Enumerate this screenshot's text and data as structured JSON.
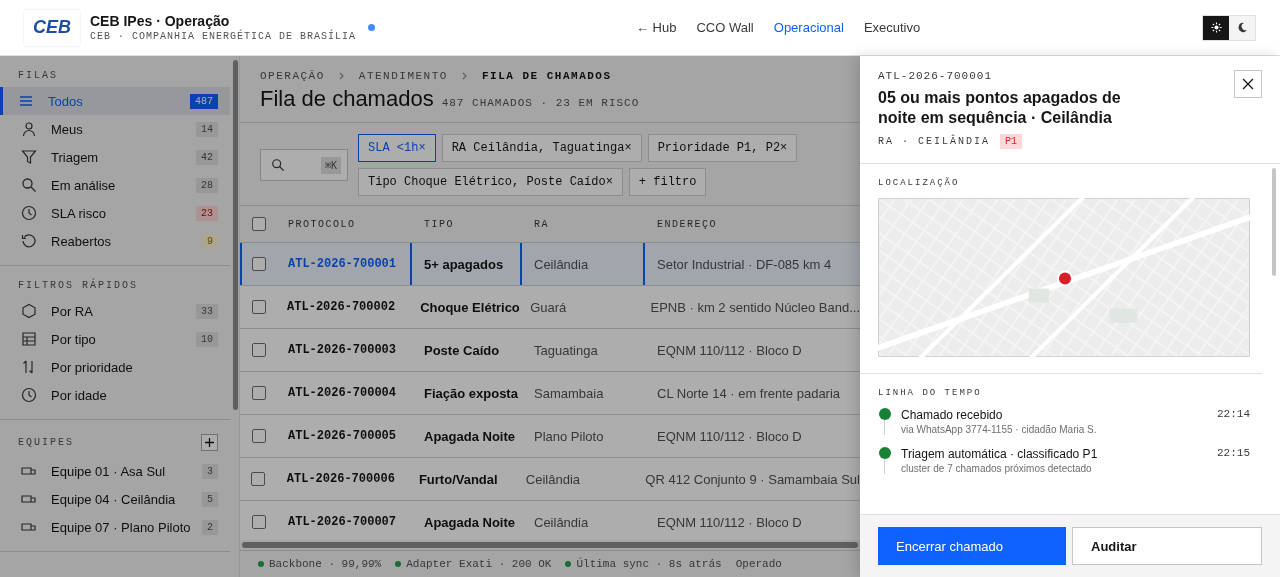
{
  "header": {
    "logo": "CEB",
    "title": "CEB IPes · Operação",
    "subtitle": "CEB · COMPANHIA ENERGÉTICA DE BRASÍLIA",
    "online": true,
    "nav": [
      {
        "label": "← Hub",
        "selected": false
      },
      {
        "label": "CCO Wall",
        "selected": false
      },
      {
        "label": "Operacional",
        "selected": true
      },
      {
        "label": "Executivo",
        "selected": false
      }
    ],
    "theme": [
      {
        "kind": "sun",
        "selected": true
      },
      {
        "kind": "moon",
        "selected": false
      }
    ]
  },
  "sidebar": {
    "sections": [
      {
        "title": "FILAS",
        "items": [
          {
            "label": "Todos",
            "count": "487",
            "kind": "primary",
            "selected": true
          },
          {
            "label": "Meus",
            "count": "14",
            "kind": "neutral",
            "selected": false
          },
          {
            "label": "Triagem",
            "count": "42",
            "kind": "neutral",
            "selected": false
          },
          {
            "label": "Em análise",
            "count": "28",
            "kind": "neutral",
            "selected": false
          },
          {
            "label": "SLA risco",
            "count": "23",
            "kind": "danger",
            "selected": false
          },
          {
            "label": "Reabertos",
            "count": "9",
            "kind": "warning",
            "selected": false
          }
        ]
      },
      {
        "title": "FILTROS RÁPIDOS",
        "items": [
          {
            "label": "Por RA",
            "count": "33",
            "kind": "neutral",
            "selected": false
          },
          {
            "label": "Por tipo",
            "count": "10",
            "kind": "neutral",
            "selected": false
          },
          {
            "label": "Por prioridade",
            "selected": false
          },
          {
            "label": "Por idade",
            "selected": false
          }
        ]
      },
      {
        "title": "EQUIPES",
        "addable": true,
        "items": [
          {
            "label": "Equipe 01 · Asa Sul",
            "count": "3",
            "kind": "neutral",
            "selected": false
          },
          {
            "label": "Equipe 04 · Ceilândia",
            "count": "5",
            "kind": "neutral",
            "selected": false
          },
          {
            "label": "Equipe 07 · Plano Piloto",
            "count": "2",
            "kind": "neutral",
            "selected": false
          }
        ]
      }
    ]
  },
  "main": {
    "breadcrumb": [
      "OPERAÇÃO",
      "ATENDIMENTO",
      "FILA DE CHAMADOS"
    ],
    "title": "Fila de chamados",
    "summary": "487 CHAMADOS · 23 EM RISCO",
    "search": {
      "shortcut": "⌘K"
    },
    "filters": [
      {
        "label": "SLA <1h",
        "active": true,
        "removable": true
      },
      {
        "label": "RA Ceilândia, Taguatinga",
        "active": false,
        "removable": true
      },
      {
        "label": "Prioridade P1, P2",
        "active": false,
        "removable": true
      },
      {
        "label": "Tipo Choque Elétrico, Poste Caído",
        "active": false,
        "removable": true
      },
      {
        "label": "+ filtro",
        "active": false,
        "removable": false
      }
    ],
    "remove_mark": "×",
    "table": {
      "all_checked": false,
      "columns": [
        "PROTOCOLO",
        "TIPO",
        "RA",
        "ENDEREÇO"
      ],
      "rows": [
        {
          "protocolo": "ATL-2026-700001",
          "tipo": "5+ apagados",
          "ra": "Ceilândia",
          "endereco": "Setor Industrial · DF-085 km 4",
          "checked": false,
          "selected": true
        },
        {
          "protocolo": "ATL-2026-700002",
          "tipo": "Choque Elétrico",
          "ra": "Guará",
          "endereco": "EPNB · km 2 sentido Núcleo Band...",
          "checked": false,
          "selected": false
        },
        {
          "protocolo": "ATL-2026-700003",
          "tipo": "Poste Caído",
          "ra": "Taguatinga",
          "endereco": "EQNM 110/112 · Bloco D",
          "checked": false,
          "selected": false
        },
        {
          "protocolo": "ATL-2026-700004",
          "tipo": "Fiação exposta",
          "ra": "Samambaia",
          "endereco": "CL Norte 14 · em frente padaria",
          "checked": false,
          "selected": false
        },
        {
          "protocolo": "ATL-2026-700005",
          "tipo": "Apagada Noite",
          "ra": "Plano Piloto",
          "endereco": "EQNM 110/112 · Bloco D",
          "checked": false,
          "selected": false
        },
        {
          "protocolo": "ATL-2026-700006",
          "tipo": "Furto/Vandal",
          "ra": "Ceilândia",
          "endereco": "QR 412 Conjunto 9 · Samambaia Sul",
          "checked": false,
          "selected": false
        },
        {
          "protocolo": "ATL-2026-700007",
          "tipo": "Apagada Noite",
          "ra": "Ceilândia",
          "endereco": "EQNM 110/112 · Bloco D",
          "checked": false,
          "selected": false
        }
      ]
    },
    "status_bar": [
      {
        "label": "Backbone · 99,99%",
        "ok": true
      },
      {
        "label": "Adapter Exati · 200 OK",
        "ok": true
      },
      {
        "label": "Última sync · 8s atrás",
        "ok": true
      },
      {
        "label": "Operado",
        "ok": false
      }
    ]
  },
  "drawer": {
    "protocolo": "ATL-2026-700001",
    "title": "05 ou mais pontos apagados de noite em sequência · Ceilândia",
    "meta": "RA · CEILÂNDIA",
    "priority": "P1",
    "location_label": "LOCALIZAÇÃO",
    "timeline_label": "LINHA DO TEMPO",
    "timeline": [
      {
        "title": "Chamado recebido",
        "detail": "via WhatsApp 3774-1155 · cidadão Maria S.",
        "time": "22:14"
      },
      {
        "title": "Triagem automática · classificado P1",
        "detail": "cluster de 7 chamados próximos detectado",
        "time": "22:15"
      }
    ],
    "actions": [
      {
        "label": "Encerrar chamado",
        "kind": "primary"
      },
      {
        "label": "Auditar",
        "kind": "secondary"
      }
    ]
  }
}
